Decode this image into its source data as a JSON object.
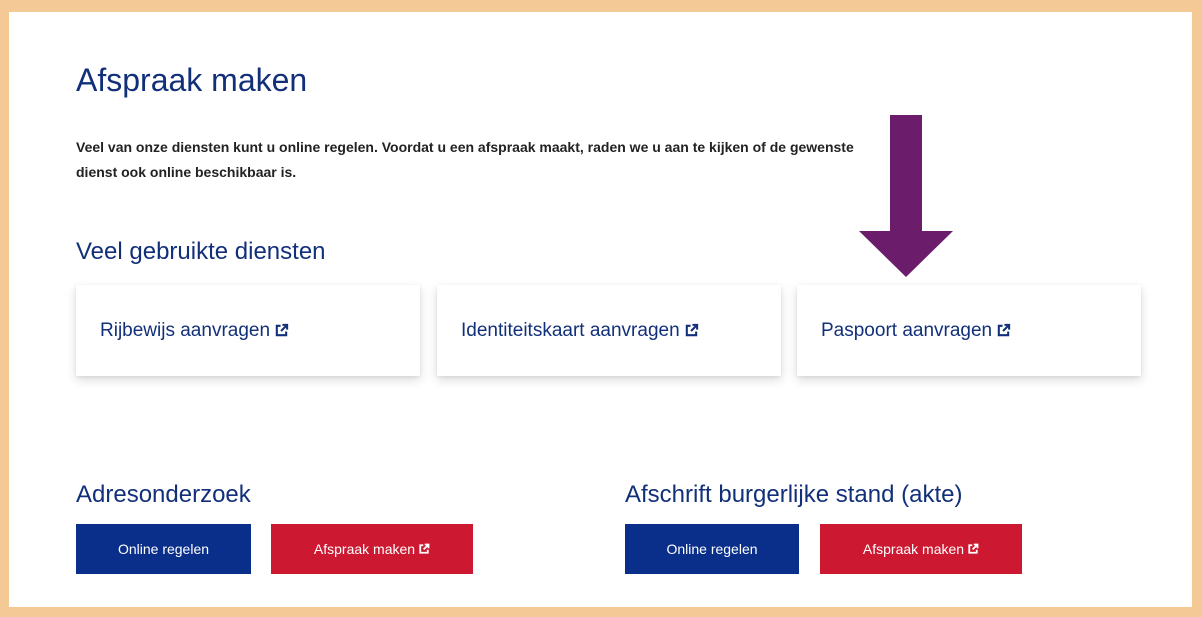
{
  "page": {
    "title": "Afspraak maken",
    "intro": "Veel van onze diensten kunt u online regelen. Voordat u een afspraak maakt, raden we u aan te kijken of de gewenste dienst ook online beschikbaar is."
  },
  "common_services": {
    "heading": "Veel gebruikte diensten",
    "items": [
      {
        "label": "Rijbewijs aanvragen",
        "icon": "external-link-icon"
      },
      {
        "label": "Identiteitskaart aanvragen",
        "icon": "external-link-icon"
      },
      {
        "label": "Paspoort aanvragen",
        "icon": "external-link-icon"
      }
    ]
  },
  "sections": [
    {
      "heading": "Adresonderzoek",
      "online_label": "Online regelen",
      "appointment_label": "Afspraak maken"
    },
    {
      "heading": "Afschrift burgerlijke stand (akte)",
      "online_label": "Online regelen",
      "appointment_label": "Afspraak maken"
    }
  ],
  "annotation": {
    "icon": "down-arrow-icon",
    "color": "#6b1d6b"
  },
  "colors": {
    "frame": "#f5c995",
    "heading": "#12307a",
    "primary_button": "#0a2f8a",
    "danger_button": "#cc1830"
  }
}
